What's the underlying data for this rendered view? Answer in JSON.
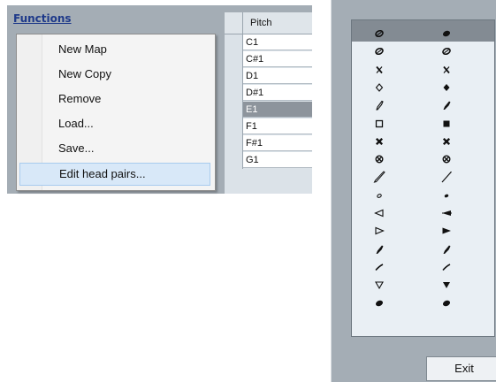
{
  "functions_menu": {
    "title": "Functions",
    "items": [
      {
        "label": "New Map"
      },
      {
        "label": "New Copy"
      },
      {
        "label": "Remove"
      },
      {
        "label": "Load..."
      },
      {
        "label": "Save..."
      },
      {
        "label": "Edit head pairs..."
      }
    ],
    "highlighted_index": 5
  },
  "pitch_table": {
    "header": "Pitch",
    "rows": [
      "C1",
      "C#1",
      "D1",
      "D#1",
      "E1",
      "F1",
      "F#1",
      "G1"
    ],
    "selected_index": 4
  },
  "head_pairs": {
    "selected_index": 0,
    "pairs": [
      {
        "left": "half-oval-slash-icon",
        "right": "filled-oval-icon"
      },
      {
        "left": "half-oval-slash-icon",
        "right": "half-oval-slash-icon"
      },
      {
        "left": "x-head-icon",
        "right": "x-head-icon"
      },
      {
        "left": "diamond-open-icon",
        "right": "diamond-filled-icon"
      },
      {
        "left": "slash-open-icon",
        "right": "slash-filled-icon"
      },
      {
        "left": "square-open-icon",
        "right": "square-filled-icon"
      },
      {
        "left": "x-bold-icon",
        "right": "x-bold-icon"
      },
      {
        "left": "circle-x-icon",
        "right": "circle-x-icon"
      },
      {
        "left": "long-slash-open-icon",
        "right": "long-slash-line-icon"
      },
      {
        "left": "small-oval-open-icon",
        "right": "small-oval-filled-icon"
      },
      {
        "left": "triangle-left-open-icon",
        "right": "triangle-left-filled-icon"
      },
      {
        "left": "triangle-right-open-icon",
        "right": "triangle-right-filled-icon"
      },
      {
        "left": "slash-filled-icon",
        "right": "slash-filled-icon"
      },
      {
        "left": "thin-slash-icon",
        "right": "thin-slash-icon"
      },
      {
        "left": "triangle-down-open-icon",
        "right": "triangle-down-filled-icon"
      },
      {
        "left": "filled-oval-icon",
        "right": "filled-oval-icon"
      }
    ]
  },
  "dialog": {
    "exit_label": "Exit"
  }
}
